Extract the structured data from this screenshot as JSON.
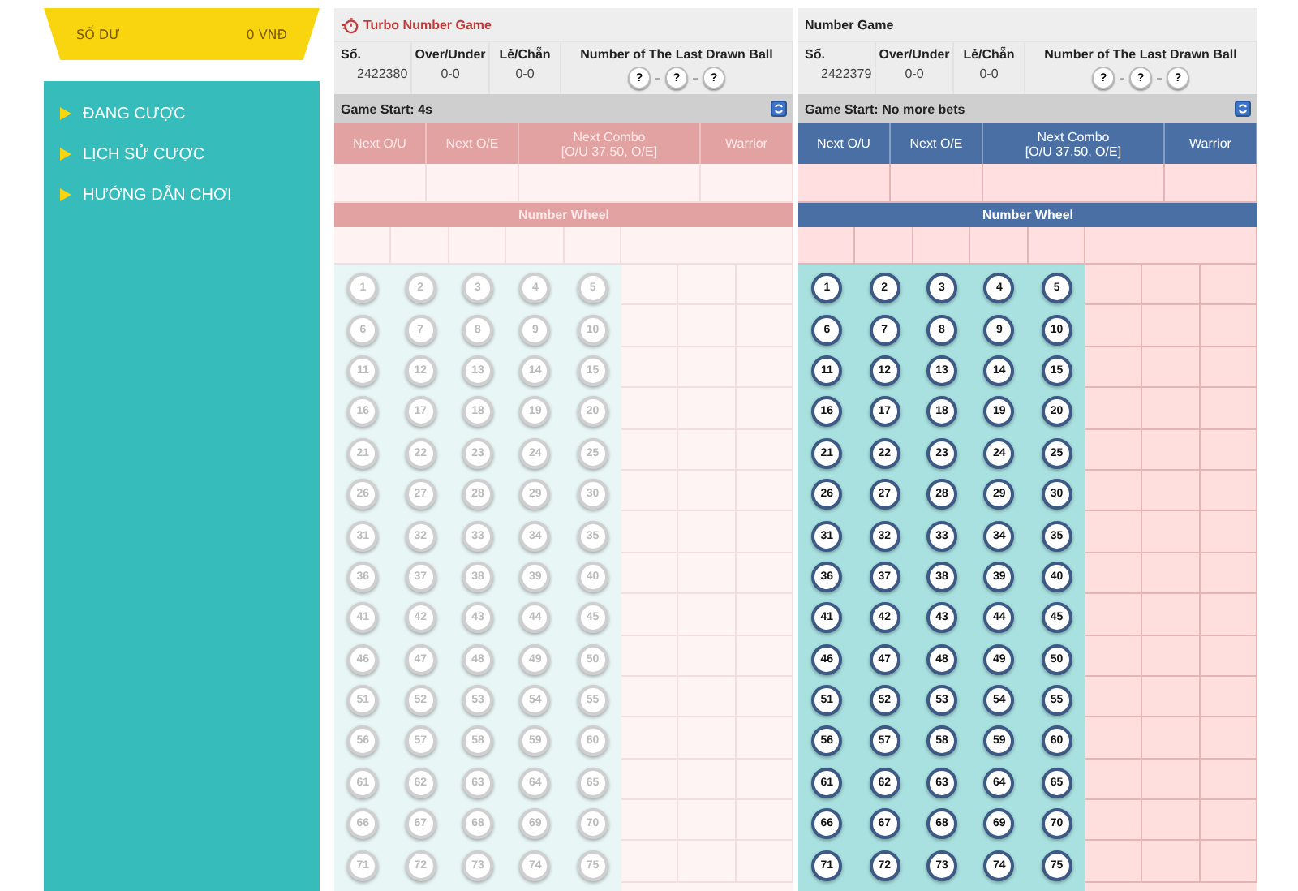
{
  "sidebar": {
    "balance": {
      "label": "SỐ DƯ",
      "value": "0 VNĐ"
    },
    "items": [
      {
        "label": "ĐANG CƯỢC"
      },
      {
        "label": "LỊCH SỬ CƯỢC"
      },
      {
        "label": "HƯỚNG DẪN CHƠI"
      }
    ]
  },
  "games": [
    {
      "kind": "turbo",
      "active": false,
      "title": "Turbo Number Game",
      "info": [
        {
          "label": "Số.",
          "value": "2422380"
        },
        {
          "label": "Over/Under",
          "value": "0-0"
        },
        {
          "label": "Lẻ/Chẵn",
          "value": "0-0"
        }
      ],
      "last_drawn": {
        "label": "Number of The Last Drawn Ball",
        "balls": [
          "?",
          "?",
          "?"
        ]
      },
      "status": "Game Start: 4s",
      "columns": [
        [
          "Next O/U"
        ],
        [
          "Next O/E"
        ],
        [
          "Next Combo",
          "[O/U 37.50, O/E]"
        ],
        [
          "Warrior"
        ]
      ],
      "wheel_title": "Number Wheel",
      "balls": [
        "1",
        "2",
        "3",
        "4",
        "5",
        "6",
        "7",
        "8",
        "9",
        "10",
        "11",
        "12",
        "13",
        "14",
        "15",
        "16",
        "17",
        "18",
        "19",
        "20",
        "21",
        "22",
        "23",
        "24",
        "25",
        "26",
        "27",
        "28",
        "29",
        "30",
        "31",
        "32",
        "33",
        "34",
        "35",
        "36",
        "37",
        "38",
        "39",
        "40",
        "41",
        "42",
        "43",
        "44",
        "45",
        "46",
        "47",
        "48",
        "49",
        "50",
        "51",
        "52",
        "53",
        "54",
        "55",
        "56",
        "57",
        "58",
        "59",
        "60",
        "61",
        "62",
        "63",
        "64",
        "65",
        "66",
        "67",
        "68",
        "69",
        "70",
        "71",
        "72",
        "73",
        "74",
        "75"
      ]
    },
    {
      "kind": "standard",
      "active": true,
      "title": "Number Game",
      "info": [
        {
          "label": "Số.",
          "value": "2422379"
        },
        {
          "label": "Over/Under",
          "value": "0-0"
        },
        {
          "label": "Lẻ/Chẵn",
          "value": "0-0"
        }
      ],
      "last_drawn": {
        "label": "Number of The Last Drawn Ball",
        "balls": [
          "?",
          "?",
          "?"
        ]
      },
      "status": "Game Start: No more bets",
      "columns": [
        [
          "Next O/U"
        ],
        [
          "Next O/E"
        ],
        [
          "Next Combo",
          "[O/U 37.50, O/E]"
        ],
        [
          "Warrior"
        ]
      ],
      "wheel_title": "Number Wheel",
      "balls": [
        "1",
        "2",
        "3",
        "4",
        "5",
        "6",
        "7",
        "8",
        "9",
        "10",
        "11",
        "12",
        "13",
        "14",
        "15",
        "16",
        "17",
        "18",
        "19",
        "20",
        "21",
        "22",
        "23",
        "24",
        "25",
        "26",
        "27",
        "28",
        "29",
        "30",
        "31",
        "32",
        "33",
        "34",
        "35",
        "36",
        "37",
        "38",
        "39",
        "40",
        "41",
        "42",
        "43",
        "44",
        "45",
        "46",
        "47",
        "48",
        "49",
        "50",
        "51",
        "52",
        "53",
        "54",
        "55",
        "56",
        "57",
        "58",
        "59",
        "60",
        "61",
        "62",
        "63",
        "64",
        "65",
        "66",
        "67",
        "68",
        "69",
        "70",
        "71",
        "72",
        "73",
        "74",
        "75"
      ]
    }
  ]
}
